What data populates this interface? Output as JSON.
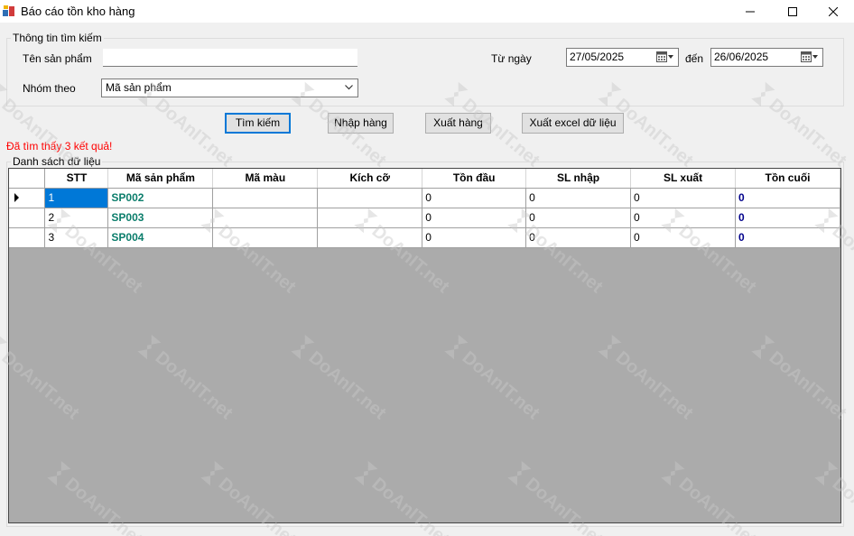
{
  "window": {
    "title": "Báo cáo tồn kho hàng"
  },
  "search": {
    "group_label": "Thông tin tìm kiếm",
    "product_name_label": "Tên sản phẩm",
    "product_name_value": "",
    "group_by_label": "Nhóm theo",
    "group_by_value": "Mã sản phẩm",
    "from_date_label": "Từ ngày",
    "from_date_value": "27/05/2025",
    "to_date_label": "đến",
    "to_date_value": "26/06/2025"
  },
  "buttons": {
    "search": "Tìm kiếm",
    "import": "Nhập hàng",
    "export": "Xuất hàng",
    "excel": "Xuất excel dữ liệu"
  },
  "result_message": "Đã tìm thấy 3 kết quả!",
  "data_list": {
    "group_label": "Danh sách dữ liệu",
    "columns": [
      "STT",
      "Mã sản phẩm",
      "Mã màu",
      "Kích cỡ",
      "Tồn đầu",
      "SL nhập",
      "SL xuất",
      "Tồn cuối"
    ],
    "rows": [
      {
        "stt": "1",
        "code": "SP002",
        "color": "",
        "size": "",
        "opening": "0",
        "imported": "0",
        "exported": "0",
        "closing": "0"
      },
      {
        "stt": "2",
        "code": "SP003",
        "color": "",
        "size": "",
        "opening": "0",
        "imported": "0",
        "exported": "0",
        "closing": "0"
      },
      {
        "stt": "3",
        "code": "SP004",
        "color": "",
        "size": "",
        "opening": "0",
        "imported": "0",
        "exported": "0",
        "closing": "0"
      }
    ]
  },
  "watermark": {
    "text": "DoAnIT.net"
  },
  "colors": {
    "selection": "#0078d7",
    "product_code": "#0b7d6b",
    "closing_stock": "#00008b",
    "result_message": "#ff0000"
  }
}
